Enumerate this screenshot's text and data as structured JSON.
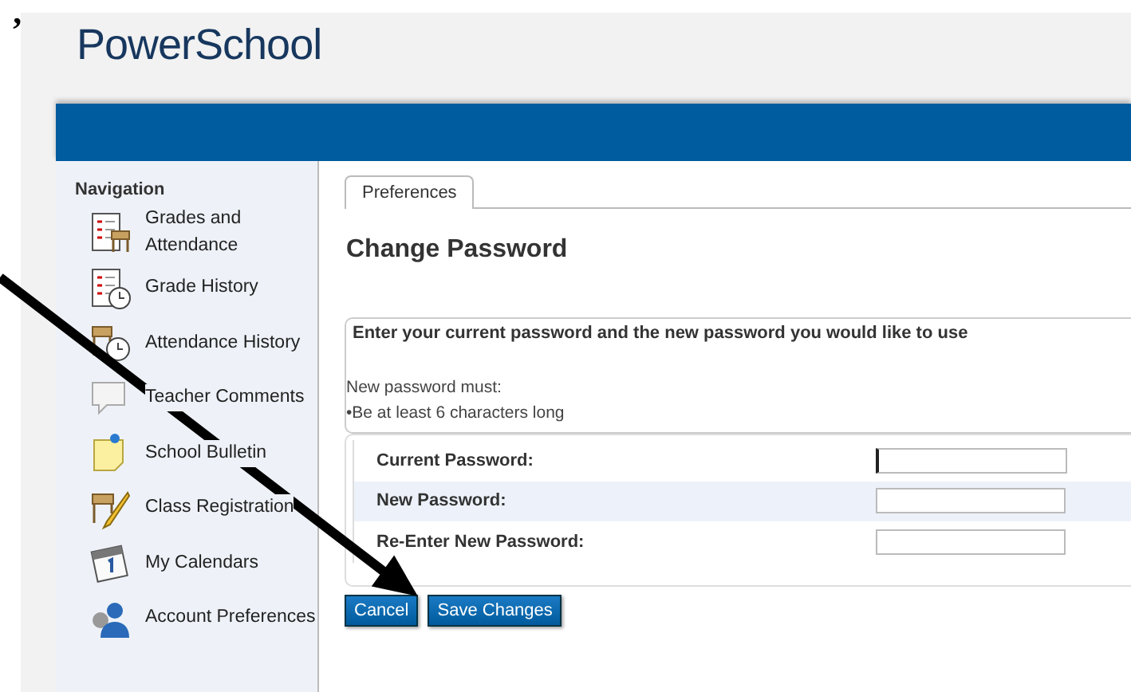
{
  "stray_mark": "’",
  "logo": "PowerSchool",
  "sidebar": {
    "title": "Navigation",
    "items": [
      {
        "label": "Grades and Attendance",
        "kind": "grades"
      },
      {
        "label": "Grade History",
        "kind": "history"
      },
      {
        "label": "Attendance History",
        "kind": "attendance"
      },
      {
        "label": "Teacher Comments",
        "kind": "comments"
      },
      {
        "label": "School Bulletin",
        "kind": "bulletin"
      },
      {
        "label": "Class Registration",
        "kind": "registration"
      },
      {
        "label": "My Calendars",
        "kind": "calendar"
      },
      {
        "label": "Account Preferences",
        "kind": "account"
      }
    ]
  },
  "tabs": [
    {
      "label": "Preferences",
      "selected": true
    }
  ],
  "heading": "Change Password",
  "instructions": {
    "title": "Enter your current password and the new password you would like to use",
    "rules_intro": "New password must:",
    "rules": [
      "•Be at least 6 characters long"
    ]
  },
  "form": {
    "fields": [
      {
        "label": "Current Password:",
        "focused": true
      },
      {
        "label": "New Password:",
        "focused": false
      },
      {
        "label": "Re-Enter New Password:",
        "focused": false
      }
    ]
  },
  "buttons": [
    "Cancel",
    "Save Changes"
  ]
}
